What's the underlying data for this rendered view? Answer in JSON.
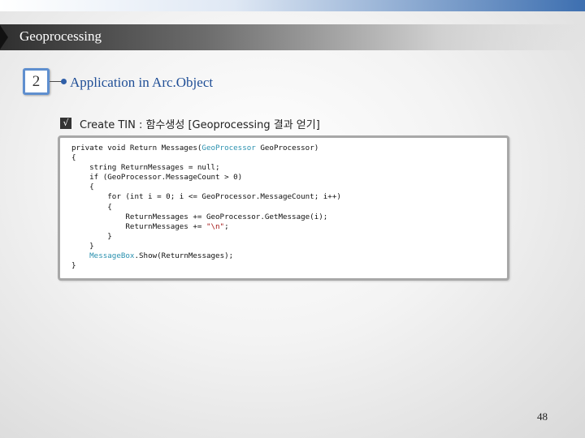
{
  "header": {
    "title": "Geoprocessing"
  },
  "section": {
    "number": "2",
    "heading": "Application in Arc.Object"
  },
  "bullet": {
    "check": "√",
    "text": "Create TIN : 함수생성 [Geoprocessing 결과 얻기]"
  },
  "code": {
    "line1a": "private void Return Messages(",
    "line1b": "GeoProcessor",
    "line1c": " GeoProcessor)",
    "line2": "{",
    "line3": "    string ReturnMessages = null;",
    "line4": "    if (GeoProcessor.MessageCount > 0)",
    "line5": "    {",
    "line6": "        for (int i = 0; i <= GeoProcessor.MessageCount; i++)",
    "line7": "        {",
    "line8": "            ReturnMessages += GeoProcessor.GetMessage(i);",
    "line9a": "            ReturnMessages += ",
    "line9b": "\"\\n\"",
    "line9c": ";",
    "line10": "        }",
    "line11": "    }",
    "line12a": "    ",
    "line12b": "MessageBox",
    "line12c": ".Show(ReturnMessages);",
    "line13": "}"
  },
  "footer": {
    "page": "48"
  },
  "colors": {
    "accent": "#1f4e96",
    "type_color": "#2b91af",
    "string_color": "#a31515"
  }
}
